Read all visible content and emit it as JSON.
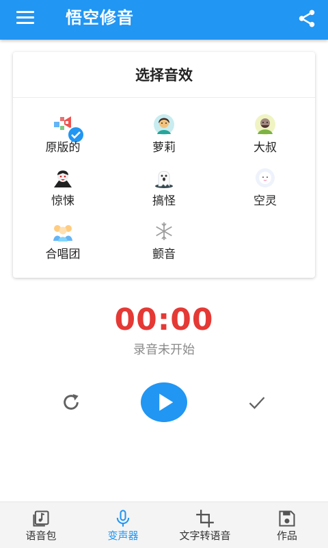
{
  "appbar": {
    "title": "悟空修音",
    "menu_icon": "menu-icon",
    "share_icon": "share-icon"
  },
  "panel": {
    "title": "选择音效",
    "effects": [
      {
        "label": "原版的",
        "icon": "original-voice-icon",
        "selected": true
      },
      {
        "label": "萝莉",
        "icon": "girl-avatar-icon",
        "selected": false
      },
      {
        "label": "大叔",
        "icon": "uncle-avatar-icon",
        "selected": false
      },
      {
        "label": "惊悚",
        "icon": "vampire-icon",
        "selected": false
      },
      {
        "label": "搞怪",
        "icon": "ghost-icon",
        "selected": false
      },
      {
        "label": "空灵",
        "icon": "ethereal-icon",
        "selected": false
      },
      {
        "label": "合唱团",
        "icon": "chorus-icon",
        "selected": false
      },
      {
        "label": "颤音",
        "icon": "snowflake-icon",
        "selected": false
      }
    ]
  },
  "recorder": {
    "timer": "00:00",
    "status": "录音未开始"
  },
  "bottom_nav": [
    {
      "label": "语音包",
      "icon": "music-file-icon",
      "active": false
    },
    {
      "label": "变声器",
      "icon": "microphone-icon",
      "active": true
    },
    {
      "label": "文字转语音",
      "icon": "crop-icon",
      "active": false
    },
    {
      "label": "作品",
      "icon": "save-icon",
      "active": false
    }
  ],
  "colors": {
    "primary": "#2196f3",
    "timer": "#e53935",
    "status_text": "#8a8a8a"
  }
}
